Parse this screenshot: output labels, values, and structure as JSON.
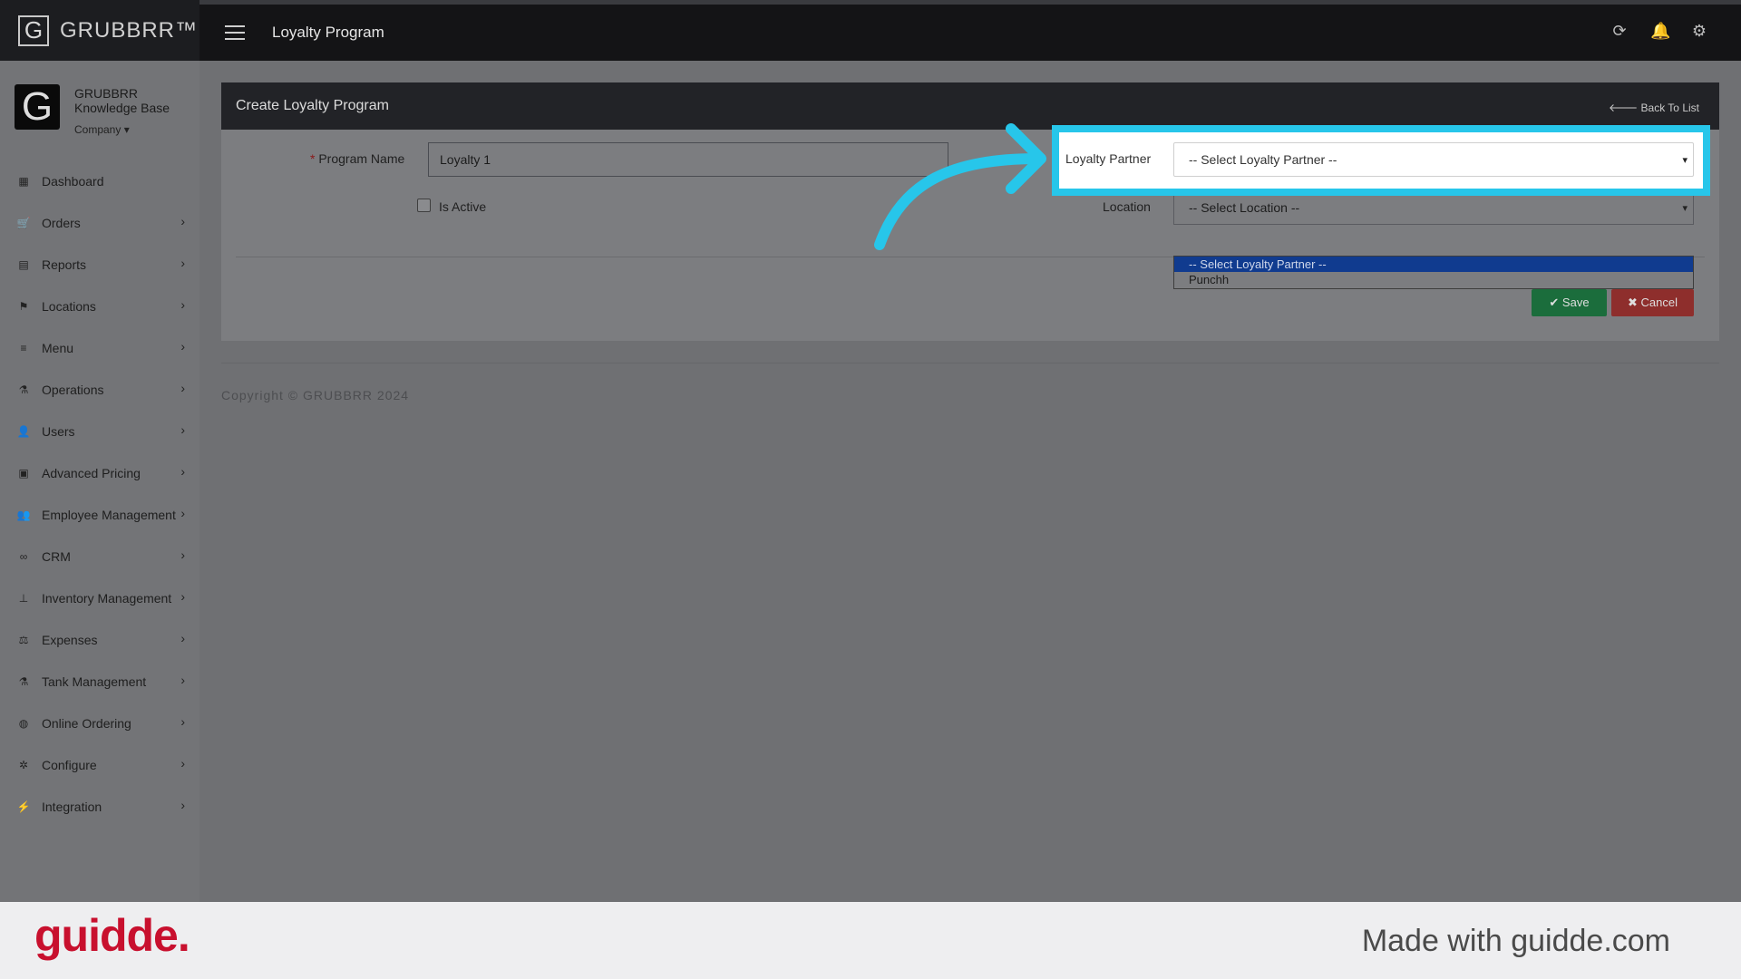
{
  "header": {
    "logo_letter": "G",
    "logo_text": "GRUBBRR™",
    "title": "Loyalty Program",
    "icons": [
      "refresh-icon",
      "bell-icon",
      "gear-icon"
    ]
  },
  "sidebar": {
    "brand_letter": "G",
    "brand_line1": "GRUBBRR",
    "brand_line2": "Knowledge Base",
    "company_label": "Company ▾",
    "items": [
      {
        "label": "Dashboard",
        "icon": "dashboard-icon",
        "glyph": "▦"
      },
      {
        "label": "Orders",
        "icon": "cart-icon",
        "glyph": "🛒"
      },
      {
        "label": "Reports",
        "icon": "report-icon",
        "glyph": "▤"
      },
      {
        "label": "Locations",
        "icon": "locations-icon",
        "glyph": "⚑"
      },
      {
        "label": "Menu",
        "icon": "menu-list-icon",
        "glyph": "≡"
      },
      {
        "label": "Operations",
        "icon": "flask-icon",
        "glyph": "⚗"
      },
      {
        "label": "Users",
        "icon": "user-plus-icon",
        "glyph": "👤"
      },
      {
        "label": "Advanced Pricing",
        "icon": "money-icon",
        "glyph": "▣"
      },
      {
        "label": "Employee Management",
        "icon": "users-icon",
        "glyph": "👥"
      },
      {
        "label": "CRM",
        "icon": "link-icon",
        "glyph": "∞"
      },
      {
        "label": "Inventory Management",
        "icon": "sitemap-icon",
        "glyph": "⊥"
      },
      {
        "label": "Expenses",
        "icon": "balance-icon",
        "glyph": "⚖"
      },
      {
        "label": "Tank Management",
        "icon": "flask-icon",
        "glyph": "⚗"
      },
      {
        "label": "Online Ordering",
        "icon": "globe-icon",
        "glyph": "◍"
      },
      {
        "label": "Configure",
        "icon": "cog-icon",
        "glyph": "✲"
      },
      {
        "label": "Integration",
        "icon": "plug-icon",
        "glyph": "⚡"
      }
    ]
  },
  "panel": {
    "title": "Create Loyalty Program",
    "back_label": "🡐 Back To List",
    "program_name_label": "Program Name",
    "required_mark": "*",
    "program_name_value": "Loyalty 1",
    "is_active_label": "Is Active",
    "loyalty_partner_label": "Loyalty Partner",
    "loyalty_partner_value": "-- Select Loyalty Partner --",
    "location_label": "Location",
    "location_value": "-- Select Location --",
    "dropdown_options": [
      "-- Select Loyalty Partner --",
      "Punchh"
    ],
    "save_label": "✔ Save",
    "cancel_label": "✖ Cancel"
  },
  "copyright": "Copyright © GRUBBRR 2024",
  "footer": {
    "logo": "guidde.",
    "made_with": "Made with guidde.com"
  },
  "colors": {
    "highlight": "#27c6ea",
    "save": "#1b6d3c",
    "cancel": "#8e2e2c",
    "brand_red": "#c8102e"
  }
}
